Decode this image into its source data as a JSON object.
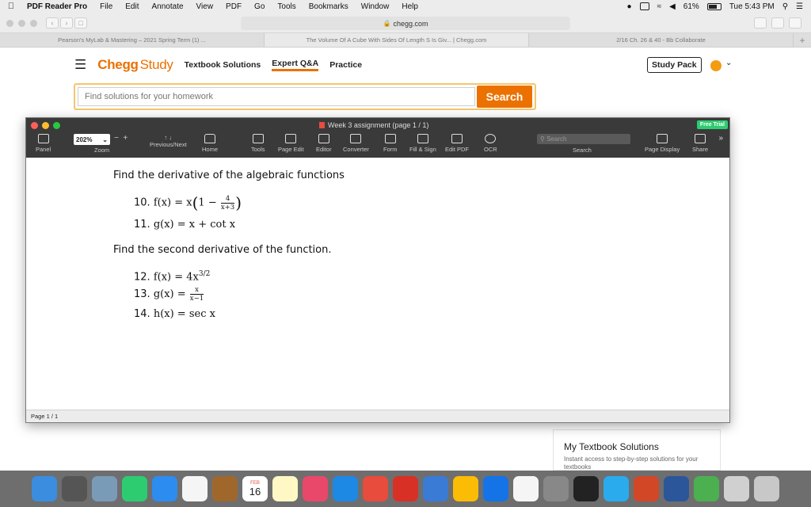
{
  "menubar": {
    "app_name": "PDF Reader Pro",
    "items": [
      "File",
      "Edit",
      "Annotate",
      "View",
      "PDF",
      "Go",
      "Tools",
      "Bookmarks",
      "Window",
      "Help"
    ],
    "battery": "61%",
    "clock": "Tue 5:43 PM"
  },
  "browser": {
    "url": "chegg.com",
    "tabs": [
      "Pearson's MyLab & Mastering – 2021 Spring Term (1) ...",
      "The Volume Of A Cube With Sides Of Length S Is Giv... | Chegg.com",
      "2/16 Ch. 26 & 40 - Bb Collaborate"
    ]
  },
  "chegg": {
    "logo_main": "Chegg",
    "logo_sub": "Study",
    "nav": [
      "Textbook Solutions",
      "Expert Q&A",
      "Practice"
    ],
    "study_pack": "Study Pack",
    "search_placeholder": "Find solutions for your homework",
    "search_button": "Search",
    "card_title": "My Textbook Solutions",
    "card_desc": "Instant access to step-by-step solutions for your textbooks"
  },
  "pdf": {
    "title": "Week 3 assignment (page 1 / 1)",
    "free_trial": "Free Trial",
    "zoom": "202%",
    "search_placeholder": "Search",
    "tools": [
      {
        "label": "Panel",
        "icon": "panel-icon"
      },
      {
        "label": "Zoom",
        "icon": "zoom-icon"
      },
      {
        "label": "Previous/Next",
        "icon": "arrows-icon"
      },
      {
        "label": "Home",
        "icon": "home-icon"
      },
      {
        "label": "Tools",
        "icon": "toolbox-icon"
      },
      {
        "label": "Page Edit",
        "icon": "grid-icon"
      },
      {
        "label": "Editor",
        "icon": "edit-icon"
      },
      {
        "label": "Converter",
        "icon": "convert-icon"
      },
      {
        "label": "Form",
        "icon": "form-icon"
      },
      {
        "label": "Fill & Sign",
        "icon": "sign-icon"
      },
      {
        "label": "Edit PDF",
        "icon": "text-icon"
      },
      {
        "label": "OCR",
        "icon": "ocr-icon"
      },
      {
        "label": "Search",
        "icon": "search-icon"
      },
      {
        "label": "Page Display",
        "icon": "display-icon"
      },
      {
        "label": "Share",
        "icon": "share-icon"
      }
    ],
    "heading1": "Find the derivative of the algebraic functions",
    "heading2": "Find the second derivative of the function.",
    "p10": {
      "num": "10.",
      "lhs": "f(x) = x",
      "one_minus": "1 −",
      "frac_num": "4",
      "frac_den": "x+3"
    },
    "p11": {
      "num": "11.",
      "expr": "g(x) = x + cot x"
    },
    "p12": {
      "num": "12.",
      "expr": "f(x) = 4x",
      "sup": "3/2"
    },
    "p13": {
      "num": "13.",
      "lhs": "g(x) =",
      "frac_num": "x",
      "frac_den": "x−1"
    },
    "p14": {
      "num": "14.",
      "expr": "h(x) = sec x"
    },
    "footer": "Page 1 / 1"
  },
  "dock": {
    "calendar_month": "FEB",
    "calendar_day": "16"
  },
  "colors": {
    "chegg_orange": "#eb7100",
    "pdf_toolbar": "#3a3a3a",
    "dock_bg": "#6e6e6e"
  }
}
